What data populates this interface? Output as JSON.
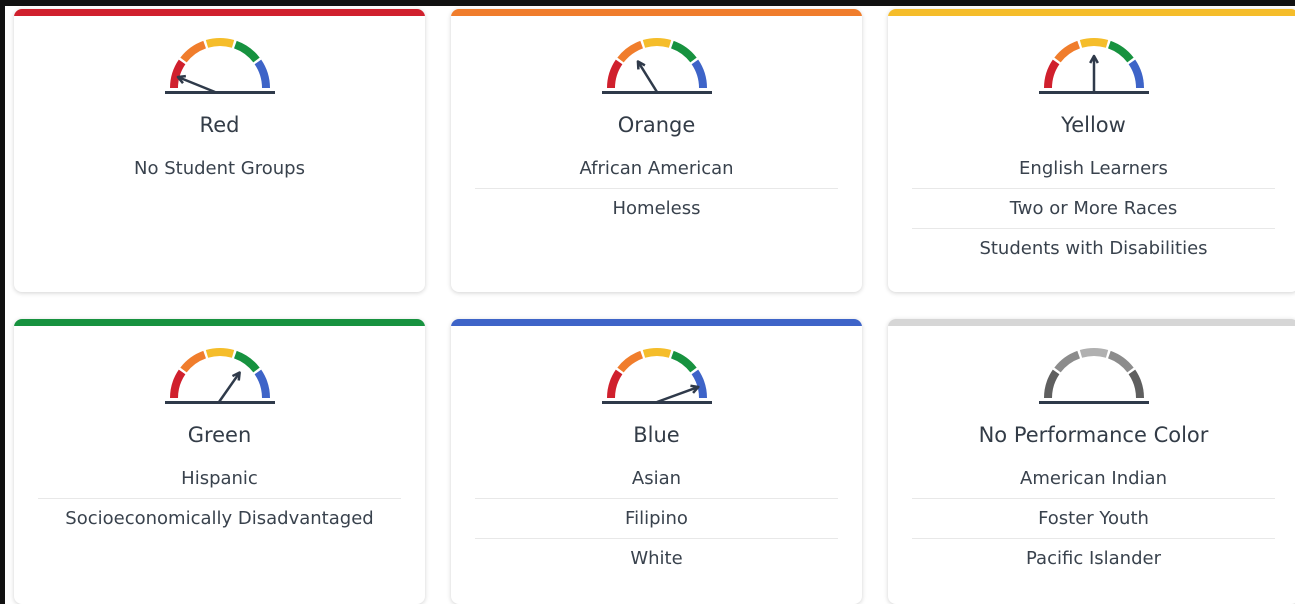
{
  "colors": {
    "red": "#d0202d",
    "orange": "#f07d2c",
    "yellow": "#f5bd2a",
    "green": "#17923f",
    "blue": "#3e64c8",
    "gray": "#d6d6d6",
    "needle": "#2f3a4a"
  },
  "cards": [
    {
      "title": "Red",
      "level": 0,
      "bar_color": "#d0202d",
      "gauge": "color",
      "groups": [
        "No Student Groups"
      ]
    },
    {
      "title": "Orange",
      "level": 1,
      "bar_color": "#f07d2c",
      "gauge": "color",
      "groups": [
        "African American",
        "Homeless"
      ]
    },
    {
      "title": "Yellow",
      "level": 2,
      "bar_color": "#f5bd2a",
      "gauge": "color",
      "groups": [
        "English Learners",
        "Two or More Races",
        "Students with Disabilities"
      ]
    },
    {
      "title": "Green",
      "level": 3,
      "bar_color": "#17923f",
      "gauge": "color",
      "groups": [
        "Hispanic",
        "Socioeconomically Disadvantaged"
      ]
    },
    {
      "title": "Blue",
      "level": 4,
      "bar_color": "#3e64c8",
      "gauge": "color",
      "groups": [
        "Asian",
        "Filipino",
        "White"
      ]
    },
    {
      "title": "No Performance Color",
      "level": null,
      "bar_color": "#d6d6d6",
      "gauge": "gray",
      "groups": [
        "American Indian",
        "Foster Youth",
        "Pacific Islander"
      ]
    }
  ]
}
